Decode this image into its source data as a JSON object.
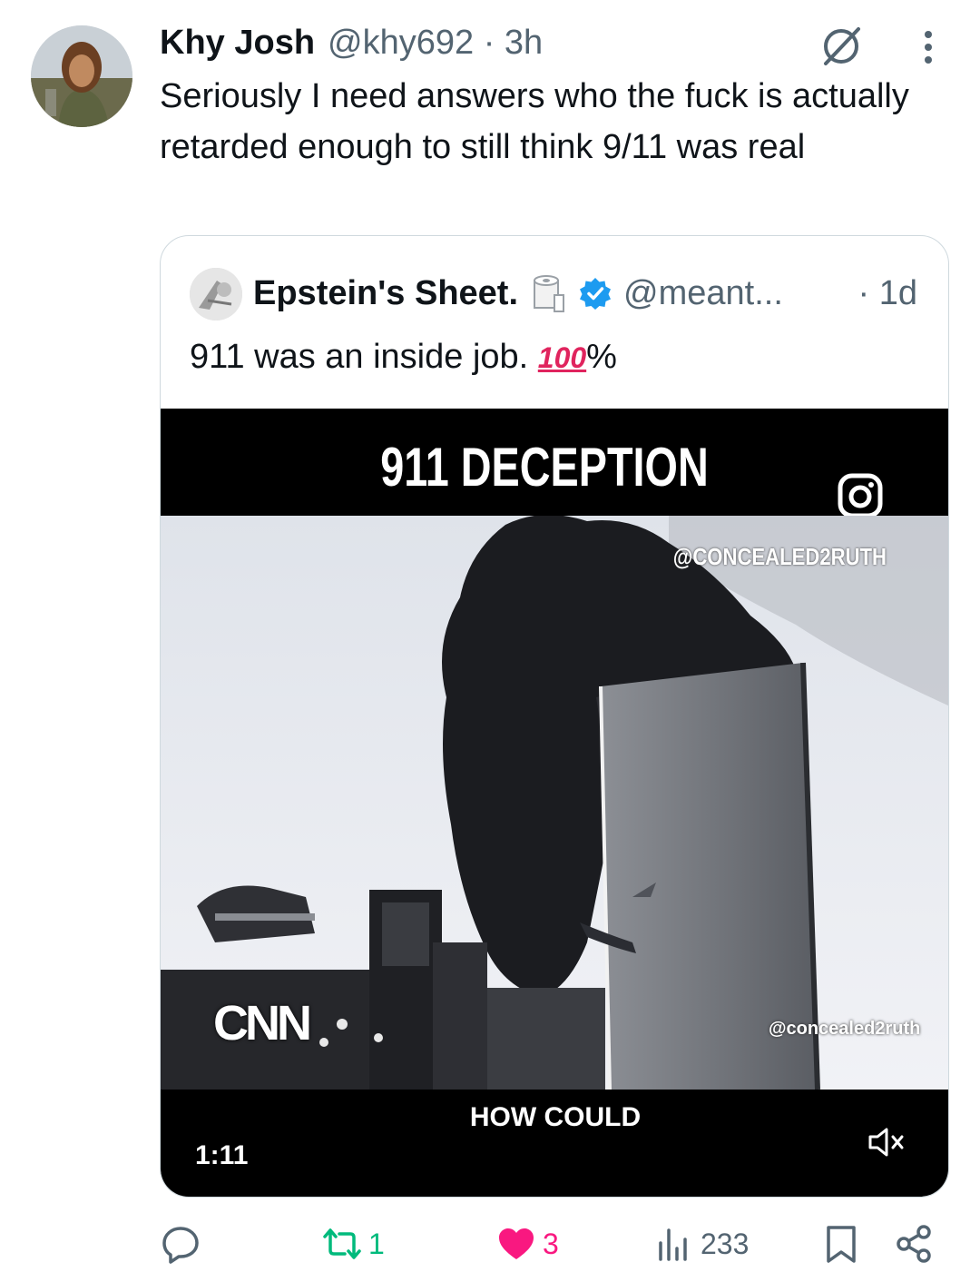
{
  "tweet": {
    "author_name": "Khy Josh",
    "author_handle": "@khy692 · 3h",
    "text": "Seriously I need answers who the fuck is actually retarded enough to still think 9/11 was real"
  },
  "quote": {
    "author_name": "Epstein's Sheet.",
    "emoji_icon": "toilet-paper-icon",
    "author_handle": "@meant...",
    "time": "· 1d",
    "text": "911 was an inside job.",
    "text_suffix": "%",
    "hundred_emoji": "100",
    "video": {
      "title": "911 DECEPTION",
      "watermark_top": "@CONCEALED2RUTH",
      "watermark_bottom": "@concealed2ruth",
      "logo": "CNN",
      "caption": "HOW COULD",
      "timestamp": "1:11"
    }
  },
  "actions": {
    "reply_count": "",
    "retweet_count": "1",
    "like_count": "3",
    "views_count": "233"
  },
  "colors": {
    "text": "#0f1419",
    "secondary": "#536471",
    "retweet": "#00ba7c",
    "like": "#f91880",
    "verified": "#1d9bf0"
  }
}
